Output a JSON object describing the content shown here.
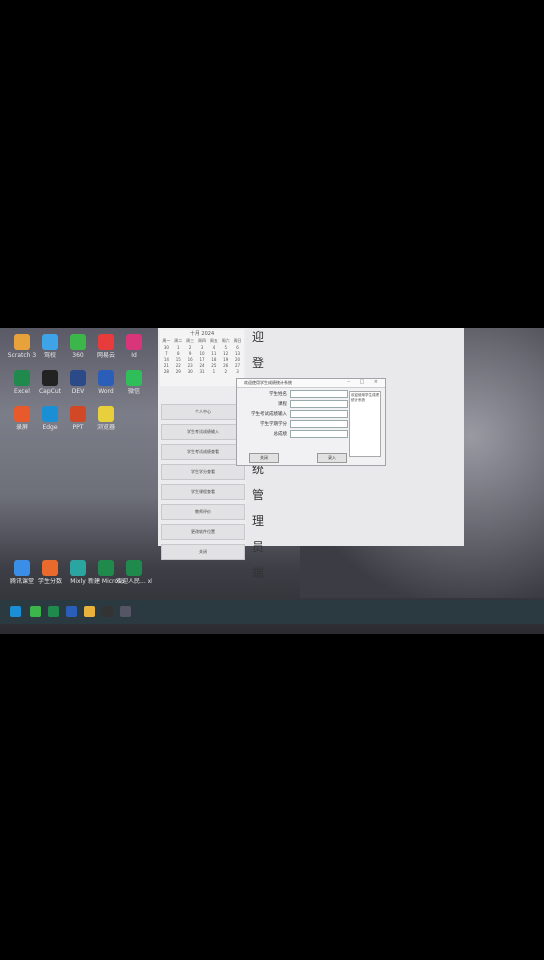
{
  "desktop": {
    "icons": [
      {
        "label": "Scratch 3",
        "color": "#e8a23c"
      },
      {
        "label": "驾校",
        "color": "#3fa3e8"
      },
      {
        "label": "360",
        "color": "#3cb54a"
      },
      {
        "label": "网易云",
        "color": "#e83c3c"
      },
      {
        "label": "Id",
        "color": "#d9357a"
      },
      {
        "label": "Excel",
        "color": "#1f8a4c"
      },
      {
        "label": "CapCut",
        "color": "#222222"
      },
      {
        "label": "DEV",
        "color": "#2c4a88"
      },
      {
        "label": "Word",
        "color": "#2b5eb8"
      },
      {
        "label": "微信",
        "color": "#2fbe5a"
      },
      {
        "label": "录屏",
        "color": "#e85a2c"
      },
      {
        "label": "Edge",
        "color": "#1a8fd6"
      },
      {
        "label": "PPT",
        "color": "#d24726"
      },
      {
        "label": "浏览器",
        "color": "#e8d03c"
      }
    ],
    "bottom_icons": [
      {
        "label": "腾讯课堂",
        "color": "#3a8ee8"
      },
      {
        "label": "学生分数",
        "color": "#e86a2c"
      },
      {
        "label": "Mixly",
        "color": "#2aa5a0"
      },
      {
        "label": "新建 Microsoft...",
        "color": "#1f8a4c"
      },
      {
        "label": "欢迎人民... xlsx",
        "color": "#1f8a4c"
      }
    ]
  },
  "app": {
    "calendar": {
      "header": "十月  2024",
      "weekdays": [
        "周一",
        "周二",
        "周三",
        "周四",
        "周五",
        "周六",
        "周日"
      ],
      "days": [
        "30",
        "1",
        "2",
        "3",
        "4",
        "5",
        "6",
        "7",
        "8",
        "9",
        "10",
        "11",
        "12",
        "13",
        "14",
        "15",
        "16",
        "17",
        "18",
        "19",
        "20",
        "21",
        "22",
        "23",
        "24",
        "25",
        "26",
        "27",
        "28",
        "29",
        "30",
        "31",
        "1",
        "2",
        "3"
      ]
    },
    "side_buttons": [
      "个人中心",
      "学生考试成绩输入",
      "学生考试成绩查看",
      "学生学分查看",
      "学生课程查看",
      "教师评价",
      "更改软件位置",
      "关闭"
    ],
    "title_chars": [
      "迎",
      "登",
      "录",
      "统",
      "管",
      "理",
      "员",
      "端"
    ]
  },
  "dialog": {
    "title": "欢迎使用学生成绩统计系统",
    "fields": [
      {
        "label": "学生姓名",
        "value": ""
      },
      {
        "label": "课程",
        "value": ""
      },
      {
        "label": "学生考试成绩输入",
        "value": ""
      },
      {
        "label": "学生学期学分",
        "value": ""
      },
      {
        "label": "总成绩",
        "value": ""
      }
    ],
    "notice": "欢迎使用学生成绩统计系统",
    "close_label": "关闭",
    "submit_label": "录入"
  }
}
